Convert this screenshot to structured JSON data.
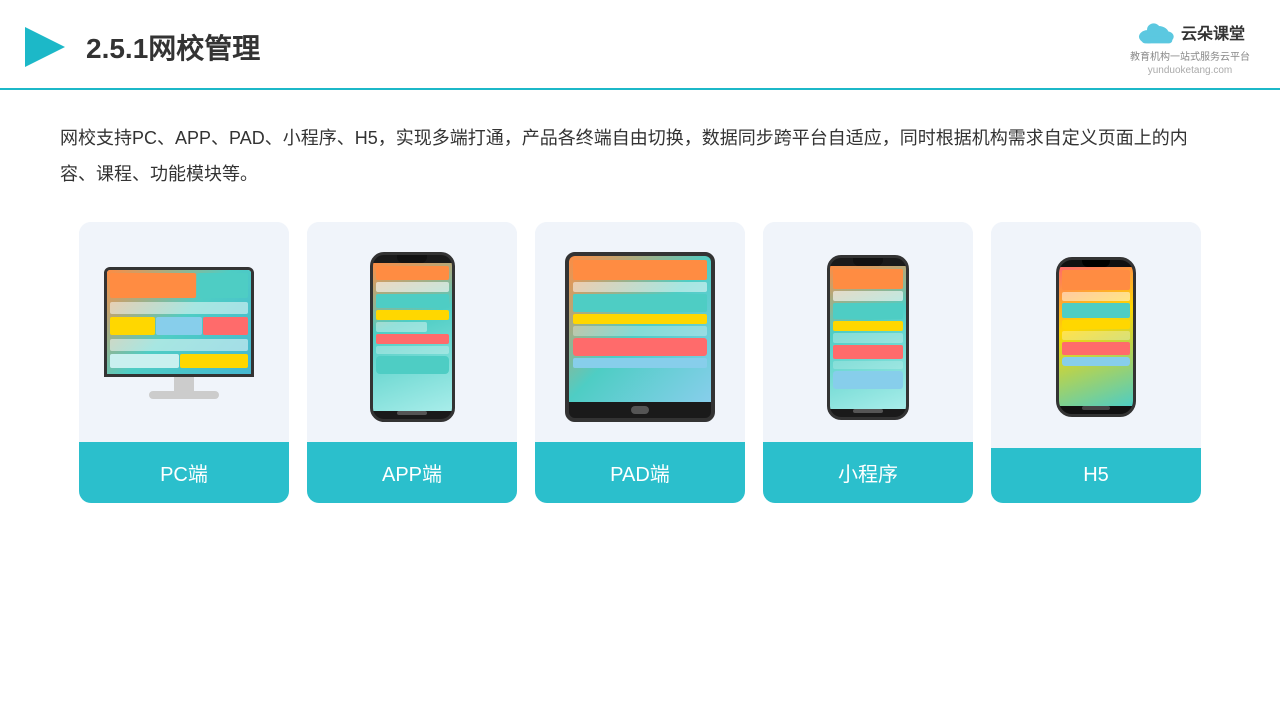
{
  "header": {
    "title": "2.5.1网校管理",
    "logo_name": "云朵课堂",
    "logo_url": "yunduoketang.com",
    "logo_tagline": "教育机构一站式服务云平台"
  },
  "description": {
    "text": "网校支持PC、APP、PAD、小程序、H5，实现多端打通，产品各终端自由切换，数据同步跨平台自适应，同时根据机构需求自定义页面上的内容、课程、功能模块等。"
  },
  "cards": [
    {
      "id": "pc",
      "label": "PC端"
    },
    {
      "id": "app",
      "label": "APP端"
    },
    {
      "id": "pad",
      "label": "PAD端"
    },
    {
      "id": "miniprogram",
      "label": "小程序"
    },
    {
      "id": "h5",
      "label": "H5"
    }
  ],
  "colors": {
    "teal": "#2bbfcc",
    "header_border": "#1cb8c8",
    "card_bg": "#f0f4fa",
    "text_dark": "#333333"
  }
}
